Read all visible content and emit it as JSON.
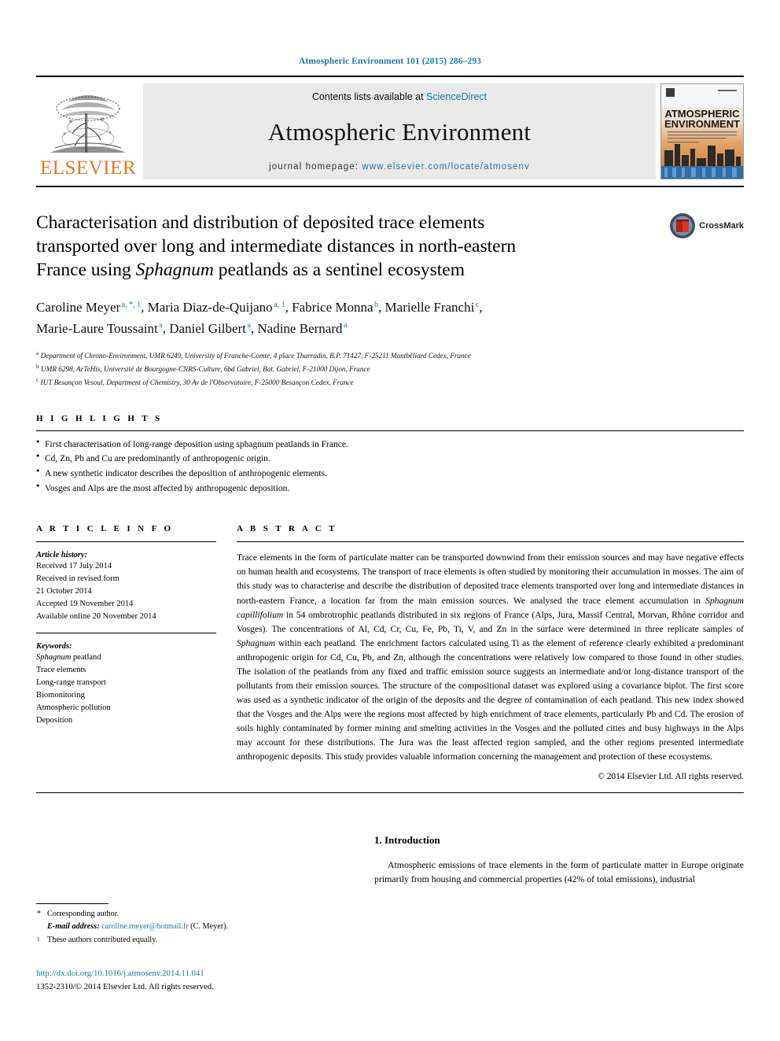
{
  "running_head": "Atmospheric Environment 101 (2015) 286–293",
  "banner": {
    "publisher_name": "ELSEVIER",
    "publisher_logo_icon": "elsevier-tree-logo",
    "contents_prefix": "Contents lists available at ",
    "contents_link": "ScienceDirect",
    "journal_title": "Atmospheric Environment",
    "homepage_prefix": "journal homepage: ",
    "homepage_url": "www.elsevier.com/locate/atmosenv",
    "cover_title_line1": "ATMOSPHERIC",
    "cover_title_line2": "ENVIRONMENT"
  },
  "title": {
    "line1": "Characterisation and distribution of deposited trace elements",
    "line2": "transported over long and intermediate distances in north-eastern",
    "line3_pre": "France using ",
    "line3_italic": "Sphagnum",
    "line3_post": " peatlands as a sentinel ecosystem",
    "crossmark_label": "CrossMark",
    "crossmark_icon": "crossmark-badge-icon"
  },
  "authors": {
    "line1": [
      {
        "name": "Caroline Meyer",
        "sup": "a, *, 1",
        "sep": ", "
      },
      {
        "name": "Maria Diaz-de-Quijano",
        "sup": "a, 1",
        "sep": ", "
      },
      {
        "name": "Fabrice Monna",
        "sup": "b",
        "sep": ", "
      },
      {
        "name": "Marielle Franchi",
        "sup": "c",
        "sep": ","
      }
    ],
    "line2": [
      {
        "name": "Marie-Laure Toussaint",
        "sup": "a",
        "sep": ", "
      },
      {
        "name": "Daniel Gilbert",
        "sup": "a",
        "sep": ", "
      },
      {
        "name": "Nadine Bernard",
        "sup": "a",
        "sep": ""
      }
    ]
  },
  "affiliations": [
    {
      "marker": "a",
      "text": "Department of Chrono-Environment, UMR 6249, University of Franche-Comte, 4 place Tharradin, B.P. 71427, F-25211 Montbéliard Cedex, France"
    },
    {
      "marker": "b",
      "text": "UMR 6298, ArTeHis, Université de Bourgogne-CNRS-Culture, 6bd Gabriel, Bat. Gabriel, F-21000 Dijon, France"
    },
    {
      "marker": "c",
      "text": "IUT Besançon Vesoul, Department of Chemistry, 30 Av de l'Observatoire, F-25000 Besançon Cedex, France"
    }
  ],
  "highlights": {
    "heading": "H I G H L I G H T S",
    "items": [
      "First characterisation of long-range deposition using sphagnum peatlands in France.",
      "Cd, Zn, Pb and Cu are predominantly of anthropogenic origin.",
      "A new synthetic indicator describes the deposition of anthropogenic elements.",
      "Vosges and Alps are the most affected by anthropogenic deposition."
    ]
  },
  "article_info": {
    "heading": "A R T I C L E  I N F O",
    "history_label": "Article history:",
    "history": [
      "Received 17 July 2014",
      "Received in revised form",
      "21 October 2014",
      "Accepted 19 November 2014",
      "Available online 20 November 2014"
    ],
    "keywords_label": "Keywords:",
    "keywords": [
      {
        "italic": "Sphagnum",
        "rest": " peatland"
      },
      {
        "italic": "",
        "rest": "Trace elements"
      },
      {
        "italic": "",
        "rest": "Long-range transport"
      },
      {
        "italic": "",
        "rest": "Biomonitoring"
      },
      {
        "italic": "",
        "rest": "Atmospheric pollution"
      },
      {
        "italic": "",
        "rest": "Deposition"
      }
    ]
  },
  "abstract": {
    "heading": "A B S T R A C T",
    "p1": "Trace elements in the form of particulate matter can be transported downwind from their emission sources and may have negative effects on human health and ecosystems. The transport of trace elements is often studied by monitoring their accumulation in mosses. The aim of this study was to characterise and describe the distribution of deposited trace elements transported over long and intermediate distances in north-eastern France, a location far from the main emission sources. We analysed the trace element accumulation in ",
    "sp1": "Sphagnum capillifolium",
    "p2": " in 54 ombrotrophic peatlands distributed in six regions of France (Alps, Jura, Massif Central, Morvan, Rhône corridor and Vosges). The concentrations of Al, Cd, Cr, Cu, Fe, Pb, Ti, V, and Zn in the surface were determined in three replicate samples of ",
    "sp2": "Sphagnum",
    "p3": " within each peatland. The enrichment factors calculated using Ti as the element of reference clearly exhibited a predominant anthropogenic origin for Cd, Cu, Pb, and Zn, although the concentrations were relatively low compared to those found in other studies. The isolation of the peatlands from any fixed and traffic emission source suggests an intermediate and/or long-distance transport of the pollutants from their emission sources. The structure of the compositional dataset was explored using a covariance biplot. The first score was used as a synthetic indicator of the origin of the deposits and the degree of contamination of each peatland. This new index showed that the Vosges and the Alps were the regions most affected by high enrichment of trace elements, particularly Pb and Cd. The erosion of soils highly contaminated by former mining and smelting activities in the Vosges and the polluted cities and busy highways in the Alps may account for these distributions. The Jura was the least affected region sampled, and the other regions presented intermediate anthropogenic deposits. This study provides valuable information concerning the management and protection of these ecosystems.",
    "copyright": "© 2014 Elsevier Ltd. All rights reserved."
  },
  "footnotes": {
    "corresponding_marker": "*",
    "corresponding_text": "Corresponding author.",
    "email_label": "E-mail address:",
    "email": "caroline.meyer@hotmail.fr",
    "email_suffix": " (C. Meyer).",
    "equal_marker": "1",
    "equal_text": "These authors contributed equally."
  },
  "footer": {
    "doi": "http://dx.doi.org/10.1016/j.atmosenv.2014.11.041",
    "issn_line": "1352-2310/© 2014 Elsevier Ltd. All rights reserved."
  },
  "introduction": {
    "heading": "1. Introduction",
    "paragraph": "Atmospheric emissions of trace elements in the form of particulate matter in Europe originate primarily from housing and commercial properties (42% of total emissions), industrial"
  },
  "colors": {
    "link_blue": "#1a7aa8",
    "elsevier_orange": "#E87722",
    "banner_grey": "#e9e9e9"
  }
}
